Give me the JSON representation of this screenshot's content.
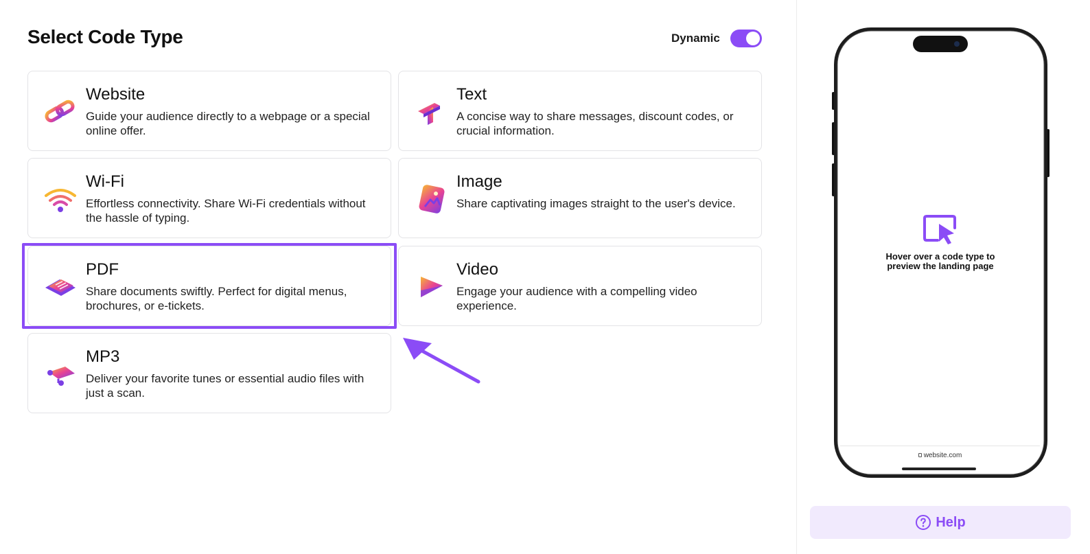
{
  "header": {
    "title": "Select Code Type",
    "dynamic_label": "Dynamic",
    "dynamic_on": true
  },
  "colors": {
    "accent": "#8b4cf6",
    "help_bg": "#f1eafd"
  },
  "code_types": [
    {
      "title": "Website",
      "description": "Guide your audience directly to a webpage or a special online offer.",
      "icon": "link-icon"
    },
    {
      "title": "Text",
      "description": "A concise way to share messages, discount codes, or crucial information.",
      "icon": "text-icon"
    },
    {
      "title": "Wi-Fi",
      "description": "Effortless connectivity. Share Wi-Fi credentials without the hassle of typing.",
      "icon": "wifi-icon"
    },
    {
      "title": "Image",
      "description": "Share captivating images straight to the user's device.",
      "icon": "image-icon"
    },
    {
      "title": "PDF",
      "description": "Share documents swiftly. Perfect for digital menus, brochures, or e-tickets.",
      "icon": "pdf-icon"
    },
    {
      "title": "Video",
      "description": "Engage your audience with a compelling video experience.",
      "icon": "video-play-icon"
    },
    {
      "title": "MP3",
      "description": "Deliver your favorite tunes or essential audio files with just a scan.",
      "icon": "music-note-icon"
    }
  ],
  "preview": {
    "hover_text": "Hover over a code type to preview the landing page",
    "url": "website.com"
  },
  "help": {
    "label": "Help"
  }
}
